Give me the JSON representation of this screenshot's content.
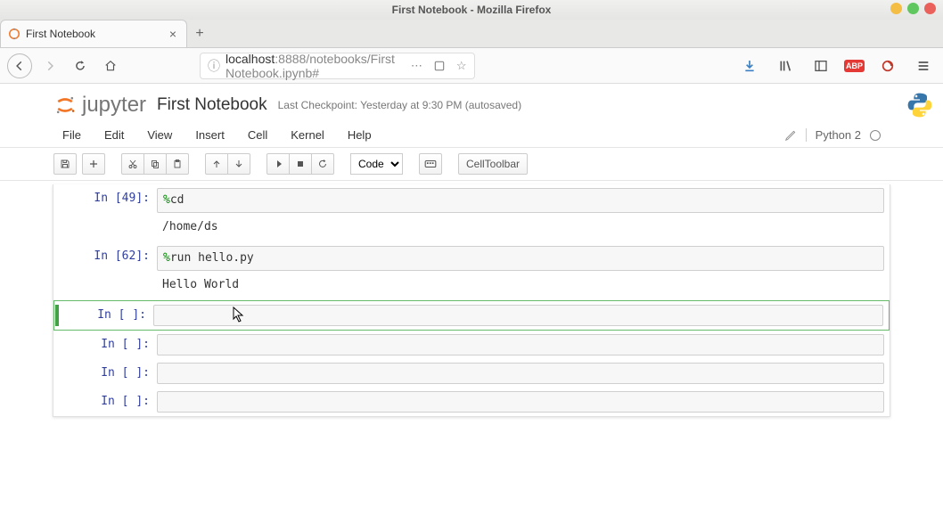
{
  "os": {
    "title": "First Notebook - Mozilla Firefox"
  },
  "tab": {
    "title": "First Notebook"
  },
  "url": {
    "host": "localhost",
    "rest": ":8888/notebooks/First Notebook.ipynb#"
  },
  "jupyter": {
    "logo_text": "jupyter",
    "nbname": "First Notebook",
    "checkpoint": "Last Checkpoint: Yesterday at 9:30 PM (autosaved)"
  },
  "menu": {
    "file": "File",
    "edit": "Edit",
    "view": "View",
    "insert": "Insert",
    "cell": "Cell",
    "kernel": "Kernel",
    "help": "Help"
  },
  "kernel": {
    "name": "Python 2"
  },
  "toolbar": {
    "celltype": "Code",
    "celltoolbar": "CellToolbar"
  },
  "cells": [
    {
      "prompt": "In [49]:",
      "code_magic": "%",
      "code_rest": "cd",
      "output": "/home/ds"
    },
    {
      "prompt": "In [62]:",
      "code_magic": "%",
      "code_rest": "run hello.py",
      "output": "Hello World"
    },
    {
      "prompt": "In [ ]:",
      "code_magic": "",
      "code_rest": "",
      "output": ""
    },
    {
      "prompt": "In [ ]:",
      "code_magic": "",
      "code_rest": "",
      "output": ""
    },
    {
      "prompt": "In [ ]:",
      "code_magic": "",
      "code_rest": "",
      "output": ""
    },
    {
      "prompt": "In [ ]:",
      "code_magic": "",
      "code_rest": "",
      "output": ""
    }
  ]
}
